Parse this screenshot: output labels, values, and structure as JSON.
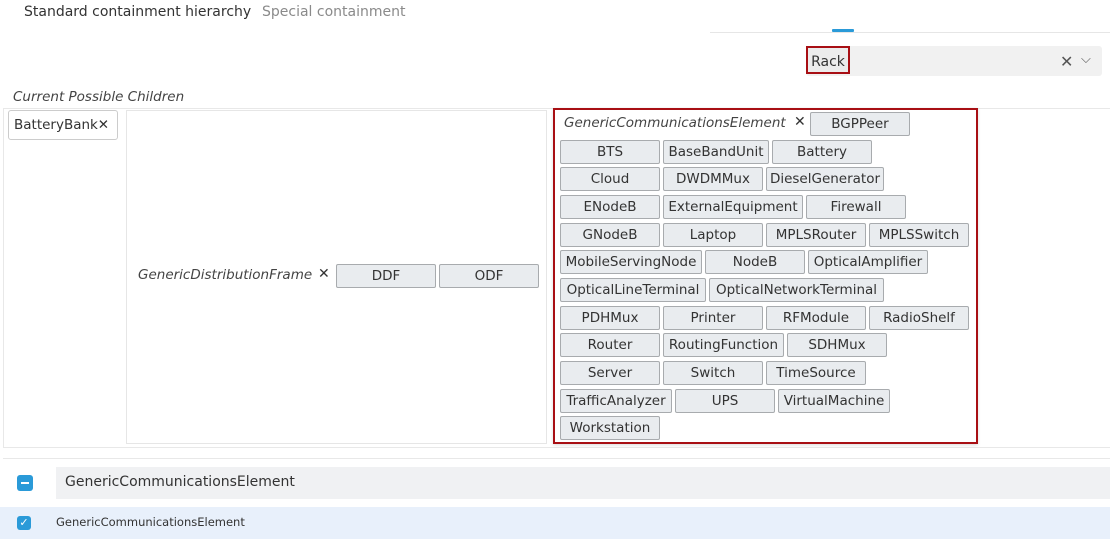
{
  "tabs": [
    {
      "label": "Standard containment hierarchy"
    },
    {
      "label": "Special containment"
    }
  ],
  "selector": {
    "value": "Rack"
  },
  "icons": {
    "clear": "×",
    "dropdown": "chevron-down",
    "remove": "×"
  },
  "panel": {
    "title": "Current Possible Children",
    "battery_label": "BatteryBank",
    "gdf": {
      "label": "GenericDistributionFrame",
      "chips": [
        "DDF",
        "ODF"
      ]
    },
    "gce": {
      "label": "GenericCommunicationsElement",
      "chips": [
        "BGPPeer",
        "BTS",
        "BaseBandUnit",
        "Battery",
        "Cloud",
        "DWDMMux",
        "DieselGenerator",
        "ENodeB",
        "ExternalEquipment",
        "Firewall",
        "GNodeB",
        "Laptop",
        "MPLSRouter",
        "MPLSSwitch",
        "MobileServingNode",
        "NodeB",
        "OpticalAmplifier",
        "OpticalLineTerminal",
        "OpticalNetworkTerminal",
        "PDHMux",
        "Printer",
        "RFModule",
        "RadioShelf",
        "Router",
        "RoutingFunction",
        "SDHMux",
        "Server",
        "Switch",
        "TimeSource",
        "TrafficAnalyzer",
        "UPS",
        "VirtualMachine",
        "Workstation"
      ]
    }
  },
  "tree": {
    "header_label": "GenericCommunicationsElement",
    "row_label": "GenericCommunicationsElement"
  },
  "colors": {
    "accent": "#2a9ad8",
    "highlight_border": "#a80f14"
  }
}
